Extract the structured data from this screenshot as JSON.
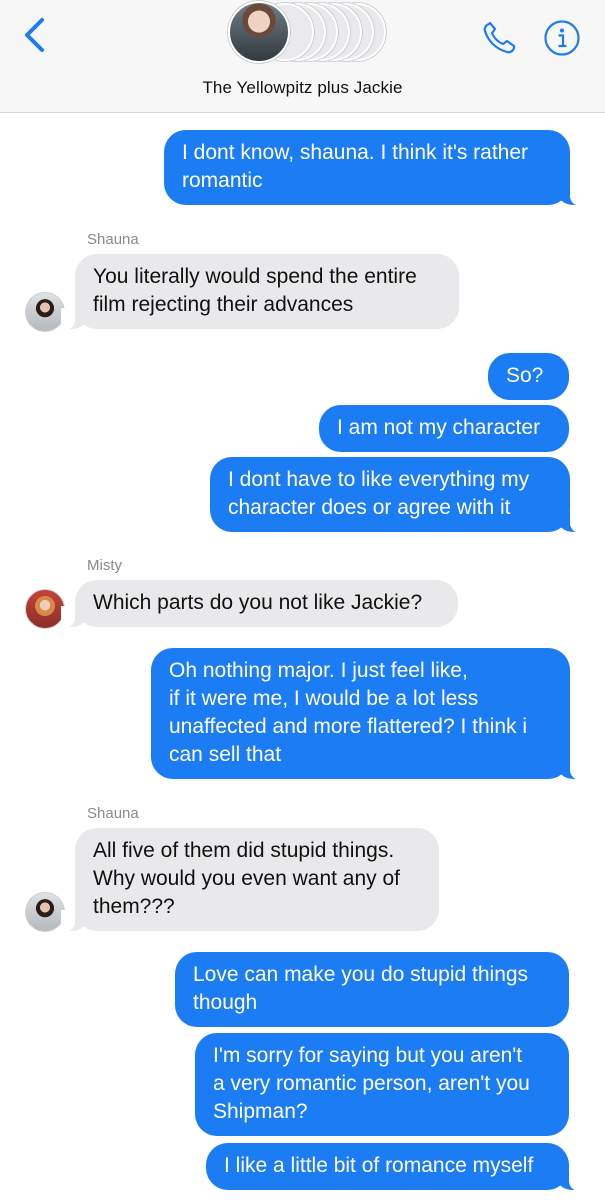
{
  "header": {
    "title": "The Yellowpitz plus Jackie",
    "back_icon": "chevron-left-icon",
    "call_icon": "phone-icon",
    "info_icon": "info-icon",
    "accent_color": "#1b7cf4"
  },
  "messages": [
    {
      "from": "me",
      "text": [
        "I dont know, shauna. I think it's rather",
        "romantic"
      ]
    },
    {
      "from": "Shauna",
      "sender_label": "Shauna",
      "text": [
        "You literally would spend the entire",
        "film rejecting their advances"
      ]
    },
    {
      "from": "me",
      "text": [
        "So?"
      ]
    },
    {
      "from": "me",
      "text": [
        "I am not my character"
      ]
    },
    {
      "from": "me",
      "text": [
        "I dont have to like everything my",
        "character does or agree with it"
      ]
    },
    {
      "from": "Misty",
      "sender_label": "Misty",
      "text": [
        "Which parts do you not like Jackie?"
      ]
    },
    {
      "from": "me",
      "text": [
        "Oh nothing major. I just feel like,",
        "if it were me, I would be a lot less",
        "unaffected and more flattered? I think i",
        "can sell that"
      ]
    },
    {
      "from": "Shauna",
      "sender_label": "Shauna",
      "text": [
        "All five of them did stupid things.",
        "Why would you even want any of",
        "them???"
      ]
    },
    {
      "from": "me",
      "text": [
        "Love can make you do stupid things",
        "though"
      ]
    },
    {
      "from": "me",
      "text": [
        "I'm sorry for saying but you aren't",
        "a very romantic person, aren't you",
        "Shipman?"
      ]
    },
    {
      "from": "me",
      "text": [
        "I like a little bit of romance myself"
      ]
    }
  ]
}
